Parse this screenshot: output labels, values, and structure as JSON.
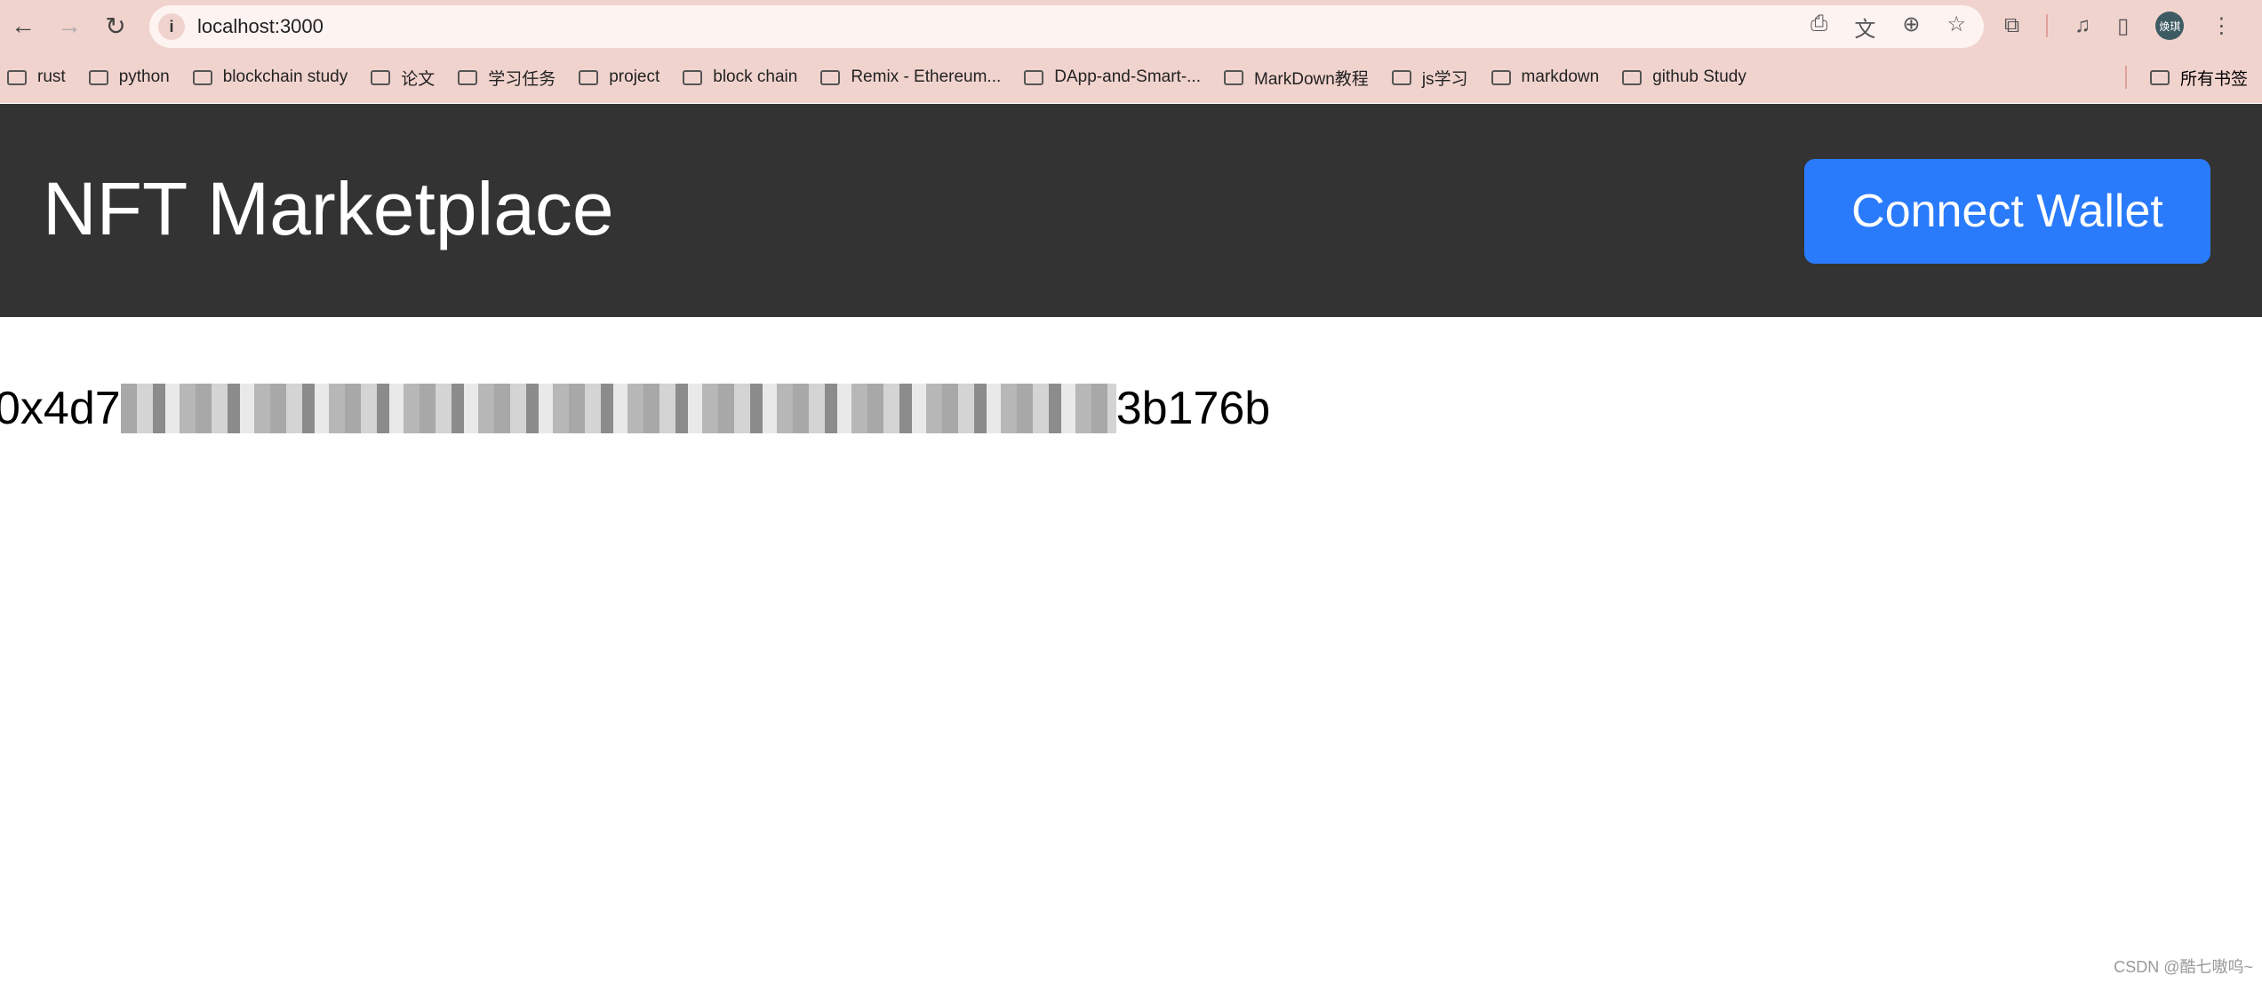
{
  "browser": {
    "url": "localhost:3000",
    "profile": "焕琪"
  },
  "bookmarks": [
    "rust",
    "python",
    "blockchain study",
    "论文",
    "学习任务",
    "project",
    "block chain",
    "Remix - Ethereum...",
    "DApp-and-Smart-...",
    "MarkDown教程",
    "js学习",
    "markdown",
    "github Study"
  ],
  "bookmarks_all": "所有书签",
  "app": {
    "title": "NFT Marketplace",
    "connect_label": "Connect Wallet",
    "address_start": "0x4d7",
    "address_end": "3b176b"
  },
  "watermark": "CSDN @酷七嗷呜~",
  "colors": {
    "header": "#333333",
    "button": "#2a7bfb",
    "chrome": "#f1d3ce"
  }
}
